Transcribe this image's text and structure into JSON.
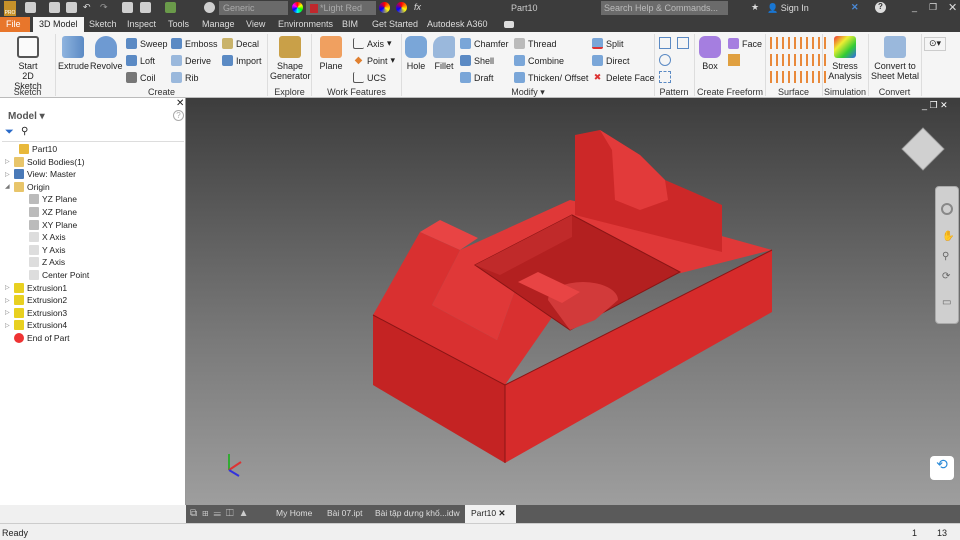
{
  "titlebar": {
    "app_badge": "PRO",
    "material": "Generic",
    "appearance": "*Light Red",
    "doc_title": "Part10",
    "search_placeholder": "Search Help & Commands...",
    "sign_in": "Sign In"
  },
  "tabs": [
    "File",
    "3D Model",
    "Sketch",
    "Inspect",
    "Tools",
    "Manage",
    "View",
    "Environments",
    "BIM",
    "Get Started",
    "Autodesk A360"
  ],
  "ribbon": {
    "sketch": {
      "label": "Sketch",
      "start": "Start",
      "start2": "2D Sketch"
    },
    "create": {
      "label": "Create",
      "extrude": "Extrude",
      "revolve": "Revolve",
      "sweep": "Sweep",
      "loft": "Loft",
      "coil": "Coil",
      "emboss": "Emboss",
      "derive": "Derive",
      "rib": "Rib",
      "decal": "Decal",
      "import": "Import"
    },
    "explore": {
      "label": "Explore",
      "shape1": "Shape",
      "shape2": "Generator"
    },
    "work": {
      "label": "Work Features",
      "plane": "Plane",
      "axis": "Axis",
      "point": "Point",
      "ucs": "UCS"
    },
    "modify": {
      "label": "Modify",
      "hole": "Hole",
      "fillet": "Fillet",
      "chamfer": "Chamfer",
      "shell": "Shell",
      "draft": "Draft",
      "thread": "Thread",
      "combine": "Combine",
      "thicken": "Thicken/ Offset",
      "split": "Split",
      "direct": "Direct",
      "delete_face": "Delete Face"
    },
    "pattern": {
      "label": "Pattern"
    },
    "freeform": {
      "label": "Create Freeform",
      "box": "Box",
      "face": "Face"
    },
    "surface": {
      "label": "Surface"
    },
    "simulation": {
      "label": "Simulation",
      "s1": "Stress",
      "s2": "Analysis"
    },
    "convert": {
      "label": "Convert",
      "c1": "Convert to",
      "c2": "Sheet Metal"
    }
  },
  "browser": {
    "title": "Model",
    "items": [
      "Part10",
      "Solid Bodies(1)",
      "View: Master",
      "Origin",
      "YZ Plane",
      "XZ Plane",
      "XY Plane",
      "X Axis",
      "Y Axis",
      "Z Axis",
      "Center Point",
      "Extrusion1",
      "Extrusion2",
      "Extrusion3",
      "Extrusion4",
      "End of Part"
    ]
  },
  "doc_tabs": [
    "My Home",
    "Bài 07.ipt",
    "Bài tập dựng khố...idw",
    "Part10"
  ],
  "status": {
    "text": "Ready",
    "n1": "1",
    "n2": "13"
  },
  "colors": {
    "part": "#d42a2a",
    "file_tab": "#e8762b"
  }
}
